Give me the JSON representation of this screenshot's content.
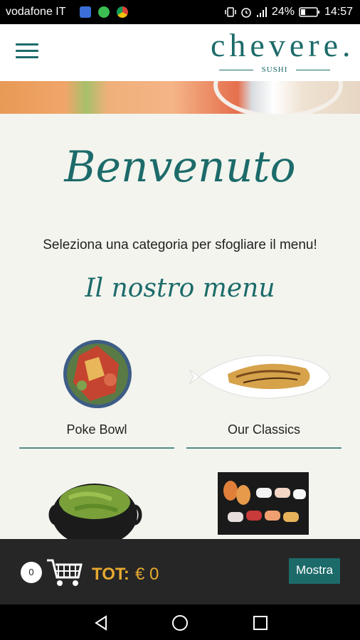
{
  "status_bar": {
    "carrier": "vodafone IT",
    "battery": "24%",
    "time": "14:57",
    "icons": [
      "messenger-icon",
      "whatsapp-icon",
      "chrome-icon",
      "vibrate-icon",
      "alarm-icon",
      "signal-icon",
      "battery-icon"
    ]
  },
  "header": {
    "logo_name": "chevere.",
    "logo_sub": "SUSHI",
    "menu_icon": "hamburger-icon"
  },
  "content": {
    "welcome": "Benvenuto",
    "subtitle": "Seleziona una categoria per sfogliare il menu!",
    "section_title": "Il nostro menu",
    "categories": [
      {
        "label": "Poke Bowl",
        "image": "poke-bowl-image"
      },
      {
        "label": "Our Classics",
        "image": "classics-plate-image"
      },
      {
        "label": "",
        "image": "edamame-pot-image"
      },
      {
        "label": "",
        "image": "sushi-tray-image"
      }
    ]
  },
  "cart": {
    "count": "0",
    "total_label": "TOT:",
    "total_value": "€ 0",
    "show_button": "Mostra"
  },
  "colors": {
    "accent": "#1c6b6a",
    "total": "#e6a930",
    "cart_bar": "#262626"
  }
}
